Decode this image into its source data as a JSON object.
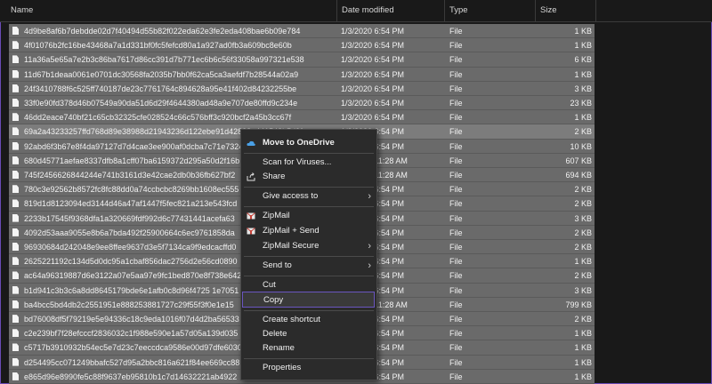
{
  "columns": {
    "name": "Name",
    "date": "Date modified",
    "type": "Type",
    "size": "Size"
  },
  "files": [
    {
      "name": "4d9be8af6b7debdde02d7f40494d55b82f022eda62e3fe2eda408bae6b09e784",
      "date": "1/3/2020 6:54 PM",
      "type": "File",
      "size": "1 KB"
    },
    {
      "name": "4f01076b2fc16be43468a7a1d331bf0fc5fefcd80a1a927ad0fb3a609bc8e60b",
      "date": "1/3/2020 6:54 PM",
      "type": "File",
      "size": "1 KB"
    },
    {
      "name": "11a36a5e65a7e2b3c86ba7617d86cc391d7b771ec6b6c56f33058a997321e538",
      "date": "1/3/2020 6:54 PM",
      "type": "File",
      "size": "6 KB"
    },
    {
      "name": "11d67b1deaa0061e0701dc30568fa2035b7bb0f62ca5ca3aefdf7b28544a02a9",
      "date": "1/3/2020 6:54 PM",
      "type": "File",
      "size": "1 KB"
    },
    {
      "name": "24f3410788f6c525ff740187de23c7761764c894628a95e41f402d84232255be",
      "date": "1/3/2020 6:54 PM",
      "type": "File",
      "size": "3 KB"
    },
    {
      "name": "33f0e90fd378d46b07549a90da51d6d29f4644380ad48a9e707de80ffd9c234e",
      "date": "1/3/2020 6:54 PM",
      "type": "File",
      "size": "23 KB"
    },
    {
      "name": "46dd2eace740bf21c65cb32325cfe028524c66c576bff3c920bcf2a45b3cc67f",
      "date": "1/3/2020 6:54 PM",
      "type": "File",
      "size": "1 KB"
    },
    {
      "name": "69a2a43233257ffd768d89e38988d21943236d122ebe91d42808e441548b5d9f",
      "date": "1/3/2020 6:54 PM",
      "type": "File",
      "size": "2 KB"
    },
    {
      "name": "92abd6f3b67e8f4da97127d7d4cae3ee900af0dcba7c71e7324",
      "date": "1/3/2020 6:54 PM",
      "type": "File",
      "size": "10 KB"
    },
    {
      "name": "680d45771aefae8337dfb8a1cff07ba6159372d295a50d2f16b",
      "date": "1/3/2020 11:28 AM",
      "type": "File",
      "size": "607 KB"
    },
    {
      "name": "745f2456626844244e741b3161d3e42cae2db0b36fb627bf2",
      "date": "1/3/2020 11:28 AM",
      "type": "File",
      "size": "694 KB"
    },
    {
      "name": "780c3e92562b8572fc8fc88dd0a74ccbcbc8269bb1608ec555",
      "date": "1/3/2020 6:54 PM",
      "type": "File",
      "size": "2 KB"
    },
    {
      "name": "819d1d8123094ed3144d46a47af1447f5fec821a213e543fcd",
      "date": "1/3/2020 6:54 PM",
      "type": "File",
      "size": "2 KB"
    },
    {
      "name": "2233b17545f9368dfa1a320669fdf992d6c77431441acefa63",
      "date": "1/3/2020 6:54 PM",
      "type": "File",
      "size": "3 KB"
    },
    {
      "name": "4092d53aaa9055e8b6a7bda492f25900664c6ec9761858da",
      "date": "1/3/2020 6:54 PM",
      "type": "File",
      "size": "2 KB"
    },
    {
      "name": "96930684d242048e9ee8ffee9637d3e5f7134ca9f9edcacffd0",
      "date": "1/3/2020 6:54 PM",
      "type": "File",
      "size": "2 KB"
    },
    {
      "name": "2625221192c134d5d0dc95a1cbaf856dac2756d2e56cd0890",
      "date": "1/3/2020 6:54 PM",
      "type": "File",
      "size": "1 KB"
    },
    {
      "name": "ac64a96319887d6e3122a07e5aa97e9fc1bed870e8f738e642",
      "date": "1/3/2020 6:54 PM",
      "type": "File",
      "size": "2 KB"
    },
    {
      "name": "b1d941c3b3c6a8dd8645179bde6e1afb0c8d96f4725 1e7051",
      "date": "1/3/2020 6:54 PM",
      "type": "File",
      "size": "3 KB"
    },
    {
      "name": "ba4bcc5bd4db2c2551951e888253881727c29f55f3f0e1e15",
      "date": "1/3/2020 11:28 AM",
      "type": "File",
      "size": "799 KB"
    },
    {
      "name": "bd76008df5f79219e5e94336c18c9eda1016f07d4d2ba56533",
      "date": "1/3/2020 6:54 PM",
      "type": "File",
      "size": "2 KB"
    },
    {
      "name": "c2e239bf7f28efcccf2836032c1f988e590e1a57d05a139d035",
      "date": "1/3/2020 6:54 PM",
      "type": "File",
      "size": "1 KB"
    },
    {
      "name": "c5717b3910932b54ec5e7d23c7eeccdca9586e00d97dfe6030",
      "date": "1/3/2020 6:54 PM",
      "type": "File",
      "size": "1 KB"
    },
    {
      "name": "d254495cc071249bbafc527d95a2bbc816a621f84ee669cc88",
      "date": "1/3/2020 6:54 PM",
      "type": "File",
      "size": "1 KB"
    },
    {
      "name": "e865d96e8990fe5c88f9637eb95810b1c7d14632221ab4922",
      "date": "1/3/2020 6:54 PM",
      "type": "File",
      "size": "1 KB"
    }
  ],
  "context_menu": {
    "move_onedrive": "Move to OneDrive",
    "scan": "Scan for Viruses...",
    "share": "Share",
    "give_access": "Give access to",
    "zipmail": "ZipMail",
    "zipmail_send": "ZipMail + Send",
    "zipmail_secure": "ZipMail Secure",
    "send_to": "Send to",
    "cut": "Cut",
    "copy": "Copy",
    "create_shortcut": "Create shortcut",
    "delete": "Delete",
    "rename": "Rename",
    "properties": "Properties"
  },
  "colors": {
    "accent": "#6a56c0",
    "onedrive": "#4aa0e6",
    "zipmail": "#c8433a",
    "row": "#6a6a6a",
    "background": "#191919"
  }
}
